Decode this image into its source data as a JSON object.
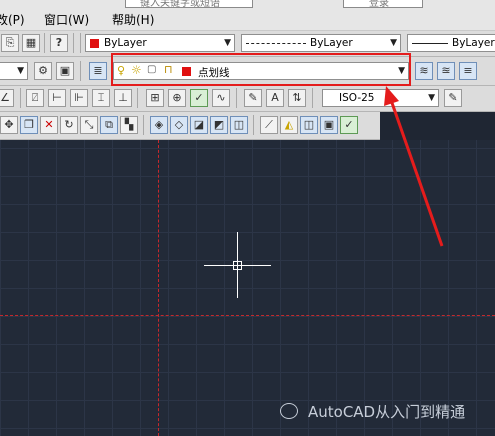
{
  "menubar": {
    "items": [
      "改(P)",
      "窗口(W)",
      "帮助(H)"
    ],
    "search_placeholder": "键入关键字或短语",
    "login_label": "登录"
  },
  "properties": {
    "color": "ByLayer",
    "linetype": "ByLayer",
    "lineweight": "ByLayer"
  },
  "layer": {
    "current": "点划线",
    "color": "#e01010"
  },
  "dimstyle": {
    "current": "ISO-25"
  },
  "watermark": {
    "text": "AutoCAD从入门到精通"
  },
  "colors": {
    "canvas": "#222a38",
    "annotation": "#e41c1c",
    "centerline": "#c6282b"
  }
}
